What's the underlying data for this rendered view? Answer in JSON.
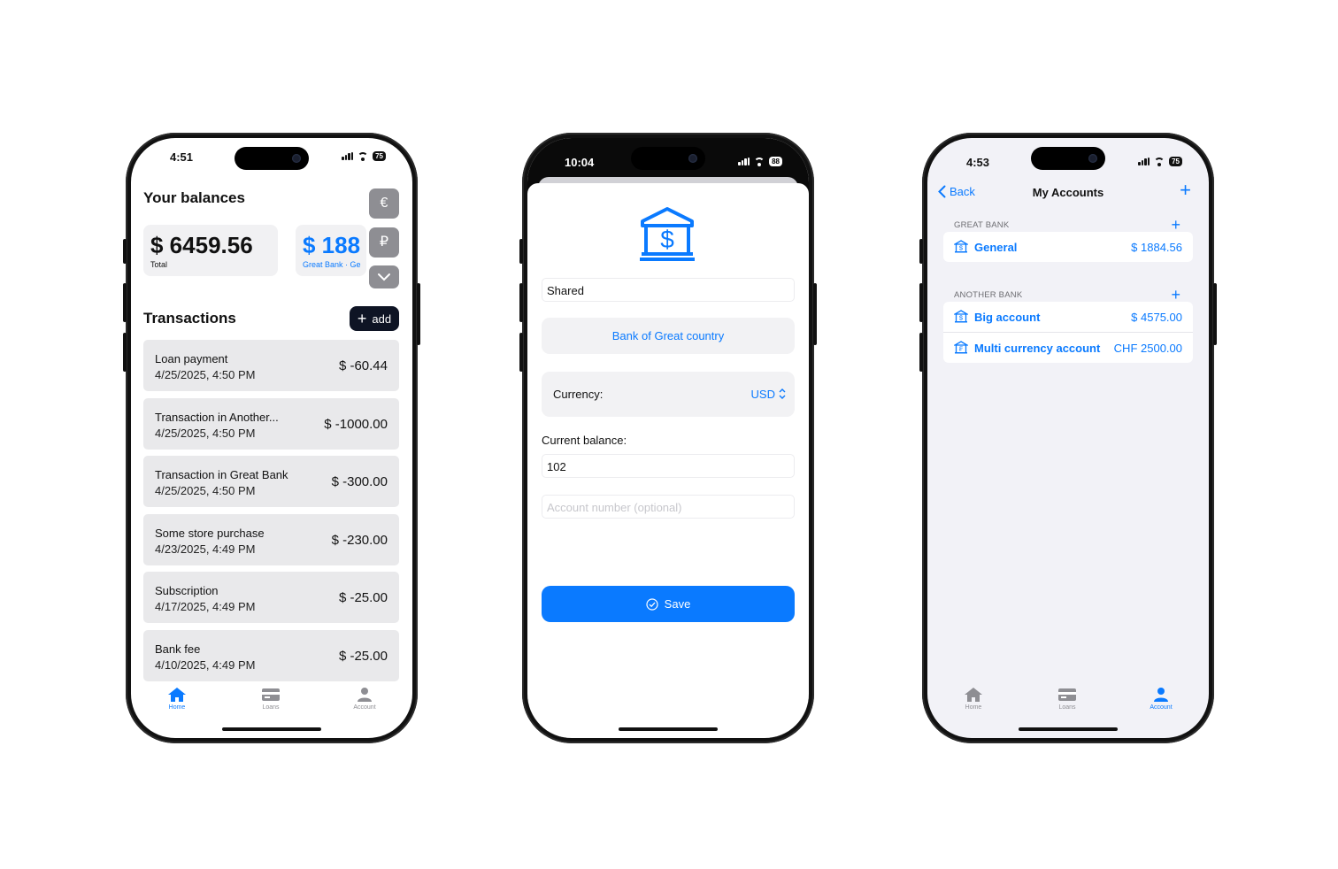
{
  "phone_home": {
    "status": {
      "time": "4:51",
      "battery": "75"
    },
    "title": "Your balances",
    "balances": [
      {
        "amount": "$ 6459.56",
        "label": "Total"
      },
      {
        "amount": "$ 188",
        "label": "Great Bank · Ge"
      }
    ],
    "currency_buttons": [
      "€",
      "₽"
    ],
    "transactions_title": "Transactions",
    "add_label": "add",
    "transactions": [
      {
        "name": "Loan payment",
        "date": "4/25/2025, 4:50 PM",
        "amount": "$ -60.44"
      },
      {
        "name": "Transaction in Another...",
        "date": "4/25/2025, 4:50 PM",
        "amount": "$ -1000.00"
      },
      {
        "name": "Transaction in Great Bank",
        "date": "4/25/2025, 4:50 PM",
        "amount": "$ -300.00"
      },
      {
        "name": "Some store purchase",
        "date": "4/23/2025, 4:49 PM",
        "amount": "$ -230.00"
      },
      {
        "name": "Subscription",
        "date": "4/17/2025, 4:49 PM",
        "amount": "$ -25.00"
      },
      {
        "name": "Bank fee",
        "date": "4/10/2025, 4:49 PM",
        "amount": "$ -25.00"
      }
    ],
    "tabs": [
      {
        "label": "Home",
        "icon": "house-icon",
        "active": true
      },
      {
        "label": "Loans",
        "icon": "card-icon",
        "active": false
      },
      {
        "label": "Account",
        "icon": "person-icon",
        "active": false
      }
    ]
  },
  "phone_form": {
    "status": {
      "time": "10:04",
      "battery": "88"
    },
    "icon": "bank-dollar-icon",
    "name_value": "Shared",
    "bank_button": "Bank of Great country",
    "currency_label": "Currency:",
    "currency_value": "USD",
    "balance_label": "Current balance:",
    "balance_value": "102",
    "account_number_placeholder": "Account number (optional)",
    "save_label": "Save"
  },
  "phone_accounts": {
    "status": {
      "time": "4:53",
      "battery": "75"
    },
    "back_label": "Back",
    "title": "My Accounts",
    "sections": [
      {
        "header": "GREAT BANK",
        "accounts": [
          {
            "name": "General",
            "balance": "$ 1884.56"
          }
        ]
      },
      {
        "header": "ANOTHER BANK",
        "accounts": [
          {
            "name": "Big account",
            "balance": "$ 4575.00"
          },
          {
            "name": "Multi currency account",
            "balance": "CHF 2500.00"
          }
        ]
      }
    ],
    "tabs": [
      {
        "label": "Home",
        "icon": "house-icon",
        "active": false
      },
      {
        "label": "Loans",
        "icon": "card-icon",
        "active": false
      },
      {
        "label": "Account",
        "icon": "person-icon",
        "active": true
      }
    ]
  },
  "colors": {
    "accent": "#0a7aff",
    "dark_button": "#0e1424",
    "gray_button": "#8e8e93"
  }
}
